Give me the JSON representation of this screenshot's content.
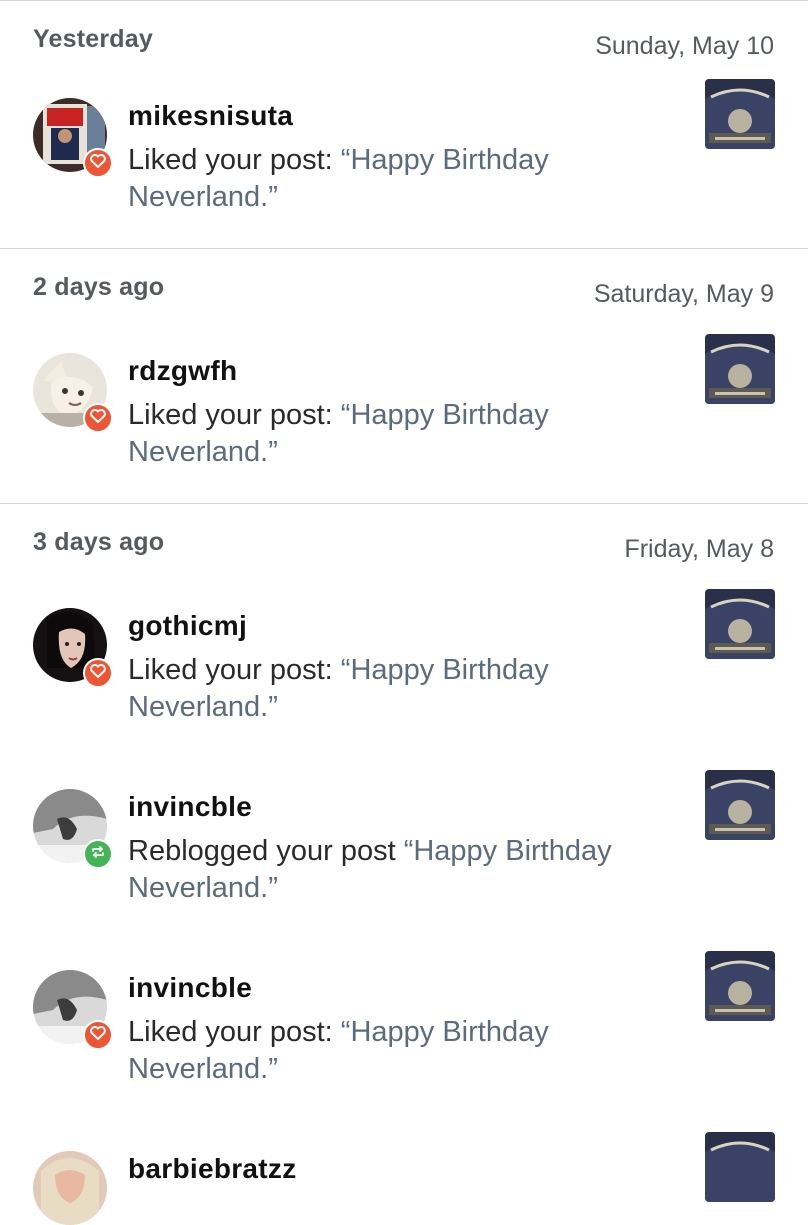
{
  "sections": [
    {
      "relative": "Yesterday",
      "date": "Sunday, May 10",
      "items": [
        {
          "username": "mikesnisuta",
          "action": "Liked your post: ",
          "post_title": "“Happy Birthday Neverland.”",
          "type": "like"
        }
      ]
    },
    {
      "relative": "2 days ago",
      "date": "Saturday, May 9",
      "items": [
        {
          "username": "rdzgwfh",
          "action": "Liked your post: ",
          "post_title": "“Happy Birthday Neverland.”",
          "type": "like"
        }
      ]
    },
    {
      "relative": "3 days ago",
      "date": "Friday, May 8",
      "items": [
        {
          "username": "gothicmj",
          "action": "Liked your post: ",
          "post_title": "“Happy Birthday Neverland.”",
          "type": "like"
        },
        {
          "username": "invincble",
          "action": "Reblogged your post ",
          "post_title": "“Happy Birthday Neverland.”",
          "type": "reblog"
        },
        {
          "username": "invincble",
          "action": "Liked your post: ",
          "post_title": "“Happy Birthday Neverland.”",
          "type": "like"
        },
        {
          "username": "barbiebratzz",
          "action": "",
          "post_title": "",
          "type": "like"
        }
      ]
    }
  ],
  "colors": {
    "like": "#ee5535",
    "reblog": "#44b556",
    "quote": "#5b6b7e"
  },
  "icons": {
    "like": "heart-icon",
    "reblog": "reblog-icon"
  }
}
